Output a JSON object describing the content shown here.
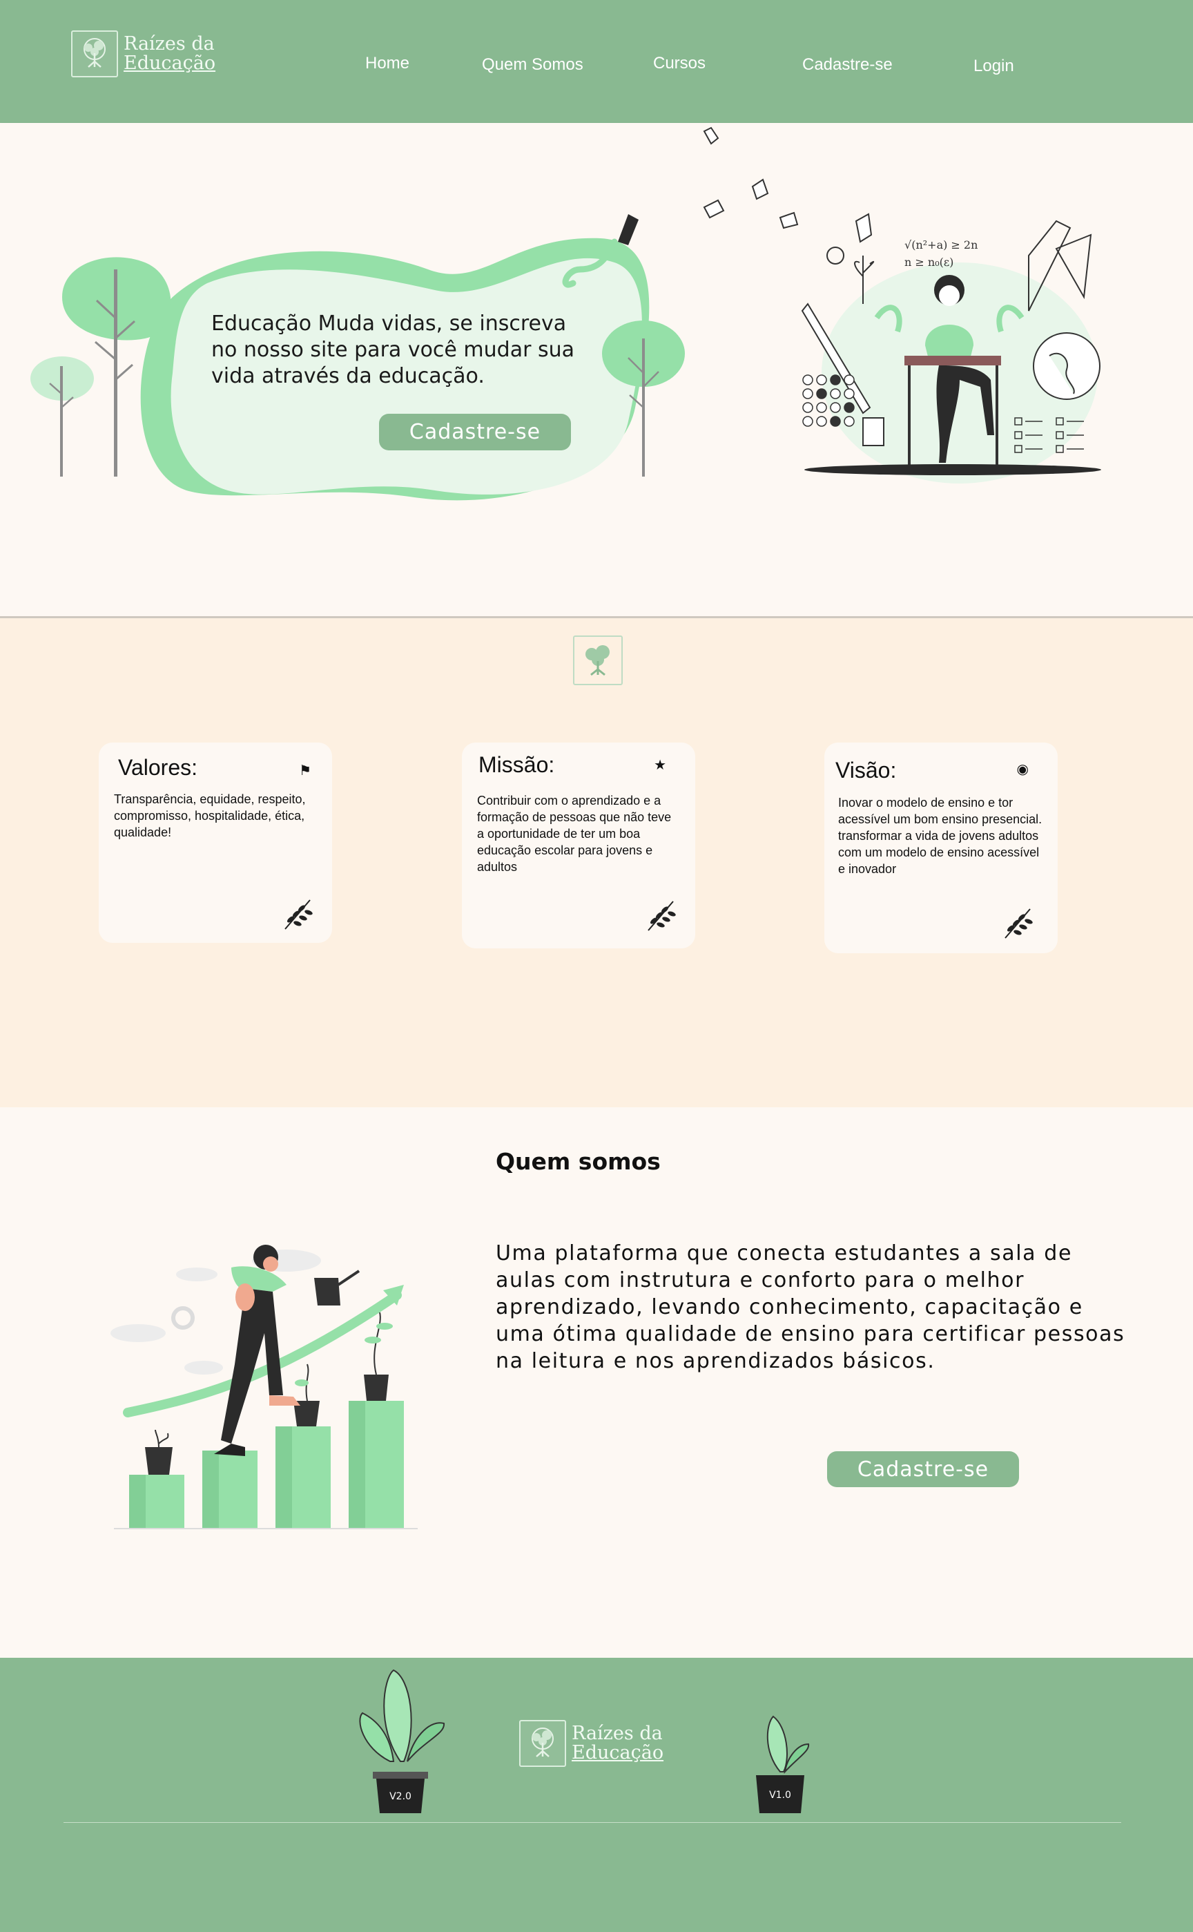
{
  "header": {
    "logo_line1": "Raízes da",
    "logo_line2": "Educação",
    "nav": [
      "Home",
      "Quem Somos",
      "Cursos",
      "Cadastre-se",
      "Login"
    ]
  },
  "hero": {
    "text": "Educação Muda vidas, se inscreva no nosso site para você mudar sua vida através da educação.",
    "button": "Cadastre-se",
    "formula_line1": "√(n²+a) ≥ 2n",
    "formula_line2": "n ≥ n₀(ε)"
  },
  "values": [
    {
      "title": "Valores:",
      "icon": "flag-icon",
      "body": "Transparência, equidade, respeito, compromisso, hospitalidade, ética, qualidade!"
    },
    {
      "title": "Missão:",
      "icon": "star-icon",
      "body": "Contribuir com o aprendizado e a formação de pessoas que não teve a oportunidade de ter um boa educação escolar para jovens e adultos"
    },
    {
      "title": "Visão:",
      "icon": "eye-icon",
      "body": "Inovar o modelo de ensino e tor acessível um bom ensino presencial. transformar a vida de jovens adultos com um modelo de ensino acessível e inovador"
    }
  ],
  "about": {
    "title": "Quem somos",
    "text": "Uma plataforma que conecta estudantes a sala de aulas com instrutura e conforto para o melhor aprendizado, levando conhecimento, capacitação e uma ótima qualidade de ensino para certificar pessoas na leitura e nos aprendizados básicos.",
    "button": "Cadastre-se"
  },
  "footer": {
    "logo_line1": "Raízes da",
    "logo_line2": "Educação",
    "pot_left_label": "V2.0",
    "pot_right_label": "V1.0"
  },
  "colors": {
    "brand_green": "#89b991",
    "light_green": "#95e0a8",
    "cream": "#fdf8f3",
    "peach": "#fdf0e1"
  }
}
